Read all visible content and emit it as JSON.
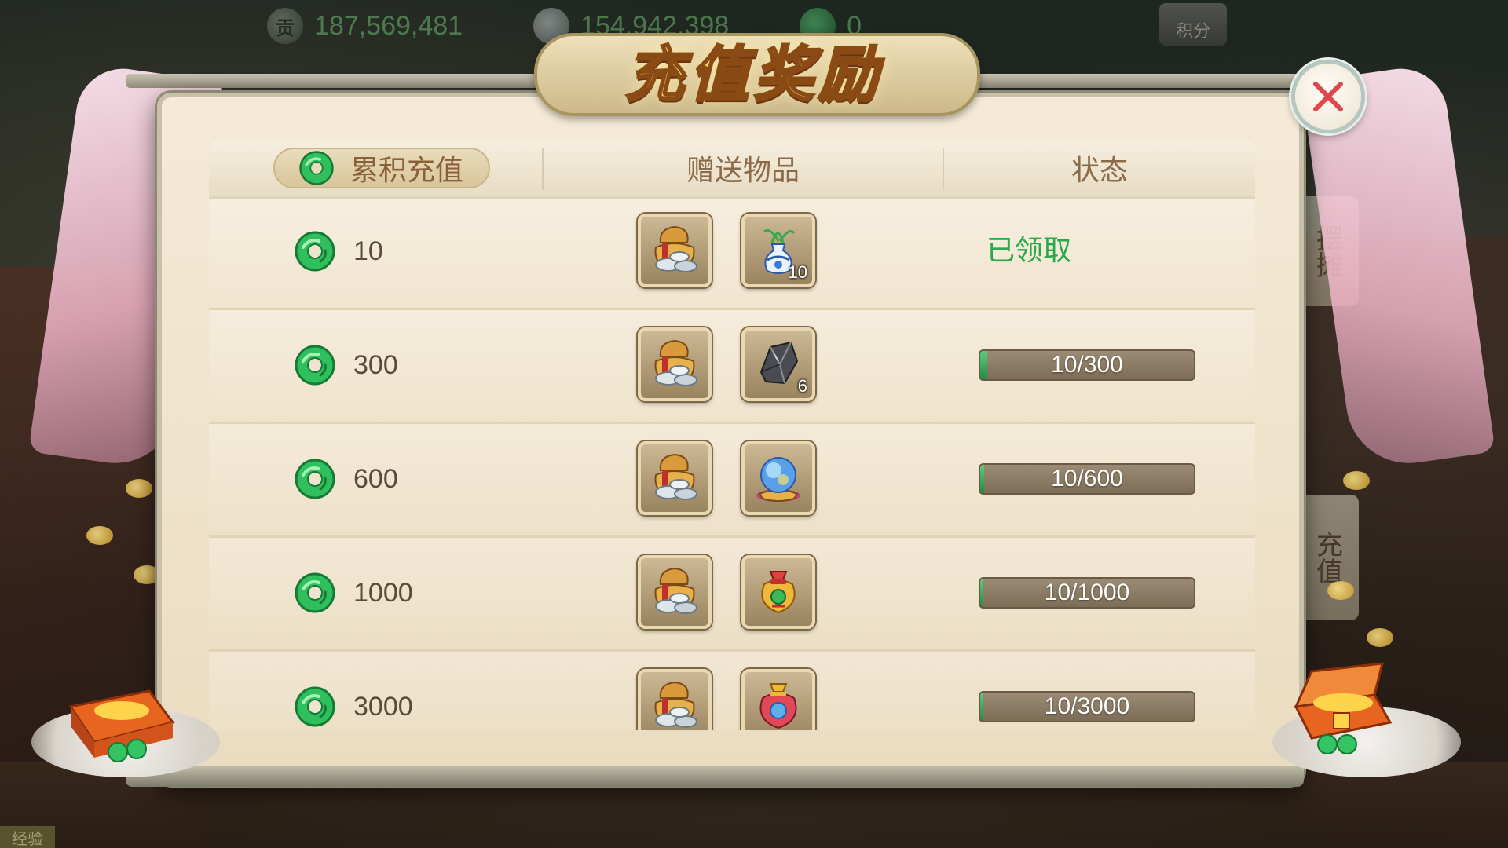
{
  "currency": {
    "contribution": "187,569,481",
    "silver": "154,942,398",
    "jade": "0",
    "contribution_icon_text": "贡"
  },
  "score_button": "积分",
  "side_tabs": [
    "摆摊",
    "充值"
  ],
  "title": "充值奖励",
  "table": {
    "headers": {
      "accumulated": "累积充值",
      "gifts": "赠送物品",
      "status": "状态"
    },
    "rows": [
      {
        "amount": "10",
        "items": [
          {
            "icon": "silver-ingot-bag-icon",
            "count": ""
          },
          {
            "icon": "porcelain-vase-icon",
            "count": "10"
          }
        ],
        "status_type": "claimed",
        "status_text": "已领取",
        "progress": null
      },
      {
        "amount": "300",
        "items": [
          {
            "icon": "silver-ingot-bag-icon",
            "count": ""
          },
          {
            "icon": "dark-ore-icon",
            "count": "6"
          }
        ],
        "status_type": "progress",
        "status_text": "10/300",
        "progress": 0.0333
      },
      {
        "amount": "600",
        "items": [
          {
            "icon": "silver-ingot-bag-icon",
            "count": ""
          },
          {
            "icon": "crystal-orb-icon",
            "count": ""
          }
        ],
        "status_type": "progress",
        "status_text": "10/600",
        "progress": 0.0167
      },
      {
        "amount": "1000",
        "items": [
          {
            "icon": "silver-ingot-bag-icon",
            "count": ""
          },
          {
            "icon": "golden-lucky-bag-icon",
            "count": ""
          }
        ],
        "status_type": "progress",
        "status_text": "10/1000",
        "progress": 0.01
      },
      {
        "amount": "3000",
        "items": [
          {
            "icon": "silver-ingot-bag-icon",
            "count": ""
          },
          {
            "icon": "red-lucky-bag-icon",
            "count": ""
          }
        ],
        "status_type": "progress",
        "status_text": "10/3000",
        "progress": 0.0033
      }
    ]
  },
  "bottom_badge": "经验",
  "colors": {
    "claimed_green": "#2aa84a",
    "progress_bar": "#8c7c65",
    "close_x": "#e0474c",
    "title_gold": "#f7d36a"
  }
}
